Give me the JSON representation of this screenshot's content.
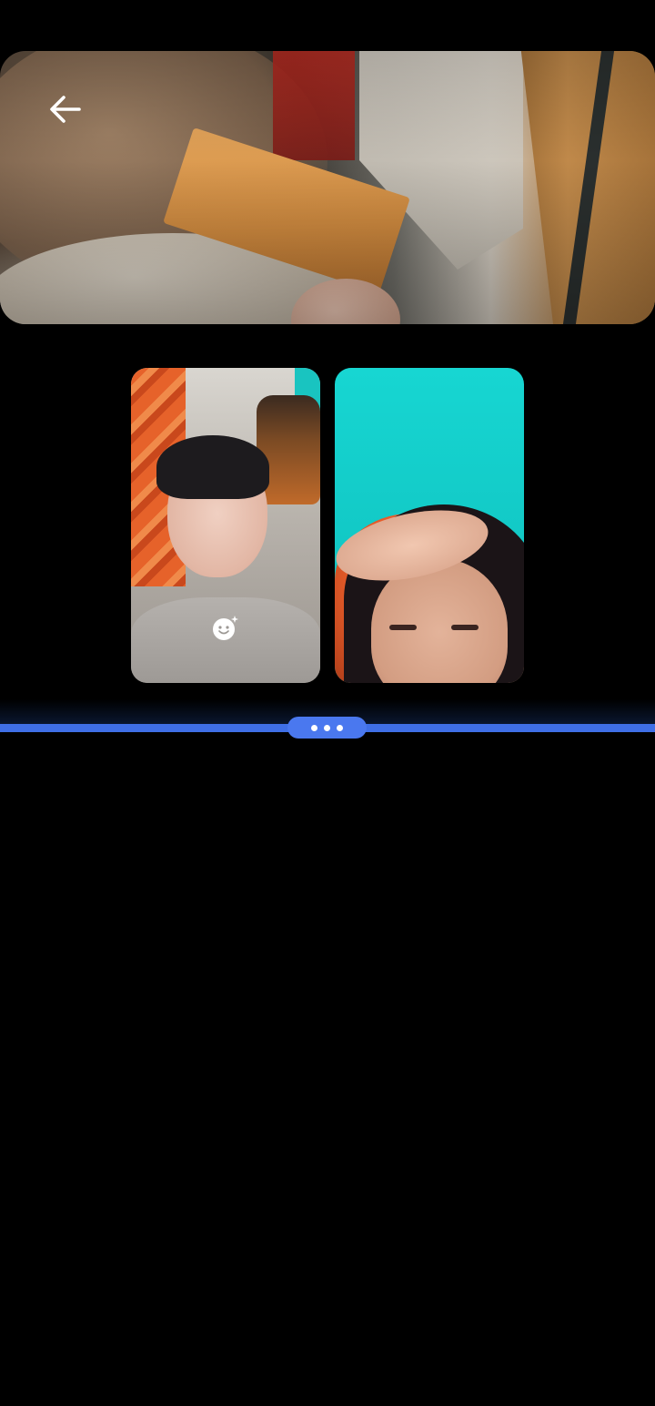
{
  "screen": {
    "background_color": "#000000"
  },
  "shared_video": {
    "back_icon": "arrow-left-icon"
  },
  "participants": [
    {
      "name": "",
      "badge_icon": "smiley-sparkle-icon"
    },
    {
      "name": ""
    }
  ],
  "divider": {
    "accent_color": "#3f6fe6",
    "handle_color": "#4a78ef",
    "handle_icon": "more-horizontal-icon"
  }
}
